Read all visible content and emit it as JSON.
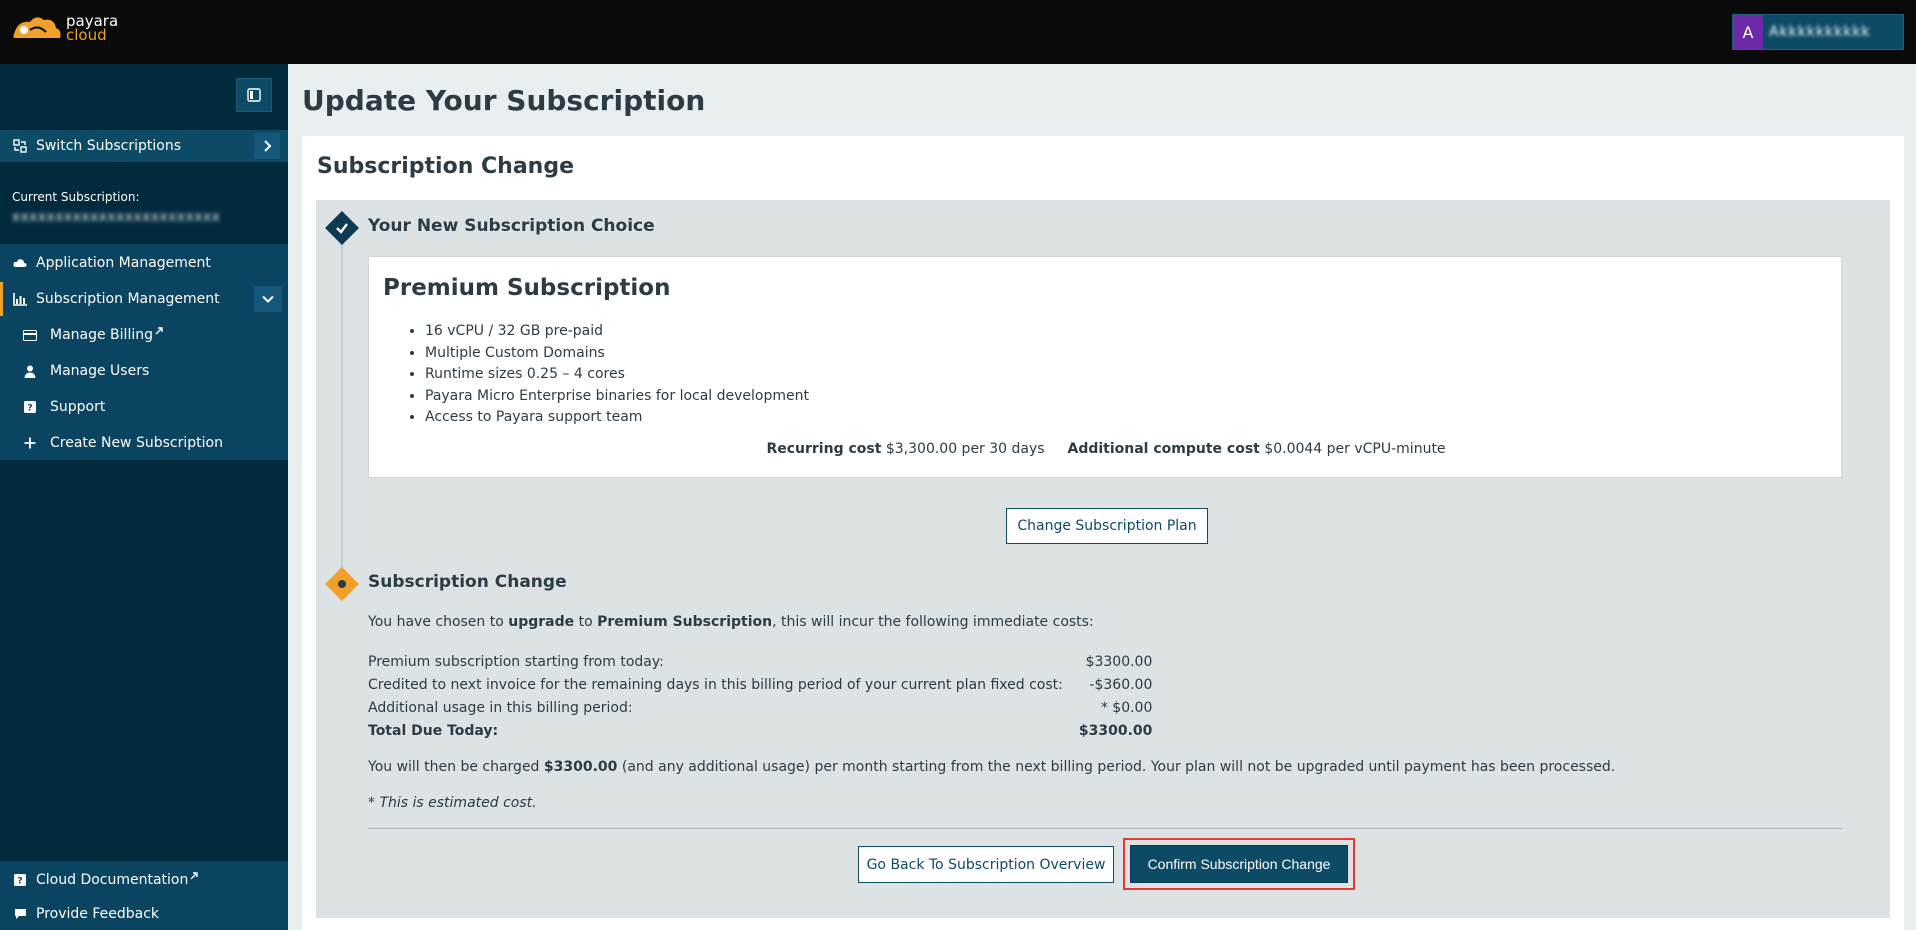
{
  "brand": {
    "line1": "payara",
    "line2": "cloud"
  },
  "user": {
    "avatar_letter": "A",
    "name_redacted": "Akkkkkkkkkk"
  },
  "sidebar": {
    "switch_label": "Switch Subscriptions",
    "current_label": "Current Subscription:",
    "current_value_redacted": "xxxxxxxxxxxxxxxxxxxxxxxx",
    "items": [
      {
        "label": "Application Management",
        "icon": "cloud-icon"
      },
      {
        "label": "Subscription Management",
        "icon": "bar-chart-icon"
      },
      {
        "label": "Manage Billing",
        "icon": "credit-card-icon",
        "external": true
      },
      {
        "label": "Manage Users",
        "icon": "user-icon"
      },
      {
        "label": "Support",
        "icon": "question-icon"
      },
      {
        "label": "Create New Subscription",
        "icon": "plus-icon"
      }
    ],
    "footer": [
      {
        "label": "Cloud Documentation",
        "icon": "question-icon",
        "external": true
      },
      {
        "label": "Provide Feedback",
        "icon": "comment-icon"
      }
    ]
  },
  "main": {
    "page_title": "Update Your Subscription",
    "card_title": "Subscription Change",
    "step1": {
      "title": "Your New Subscription Choice",
      "plan_name": "Premium Subscription",
      "features": [
        "16 vCPU / 32 GB pre-paid",
        "Multiple Custom Domains",
        "Runtime sizes 0.25 – 4 cores",
        "Payara Micro Enterprise binaries for local development",
        "Access to Payara support team"
      ],
      "recurring_label": "Recurring cost",
      "recurring_value": "$3,300.00 per 30 days",
      "compute_label": "Additional compute cost",
      "compute_value": "$0.0044 per vCPU-minute",
      "change_button": "Change Subscription Plan"
    },
    "step2": {
      "title": "Subscription Change",
      "chosen_pre": "You have chosen to ",
      "chosen_action": "upgrade",
      "chosen_mid": " to ",
      "chosen_plan": "Premium Subscription",
      "chosen_post": ", this will incur the following immediate costs:",
      "rows": [
        {
          "label": "Premium subscription starting from today:",
          "amount": "$3300.00"
        },
        {
          "label": "Credited to next invoice for the remaining days in this billing period of your current plan fixed cost:",
          "amount": "-$360.00"
        },
        {
          "label": "Additional usage in this billing period:",
          "amount": "* $0.00"
        }
      ],
      "total_label": "Total Due Today:",
      "total_amount": "$3300.00",
      "charged_pre": "You will then be charged ",
      "charged_amount": "$3300.00",
      "charged_post": " (and any additional usage) per month starting from the next billing period. Your plan will not be upgraded until payment has been processed.",
      "note": "* This is estimated cost.",
      "back_button": "Go Back To Subscription Overview",
      "confirm_button": "Confirm Subscription Change"
    }
  },
  "colors": {
    "topbar": "#0a0a0a",
    "sidebar": "#022a3d",
    "sidebar_active": "#0b4461",
    "accent": "#f0a12b",
    "primary": "#0d4a66",
    "highlight": "#e63b2e"
  }
}
